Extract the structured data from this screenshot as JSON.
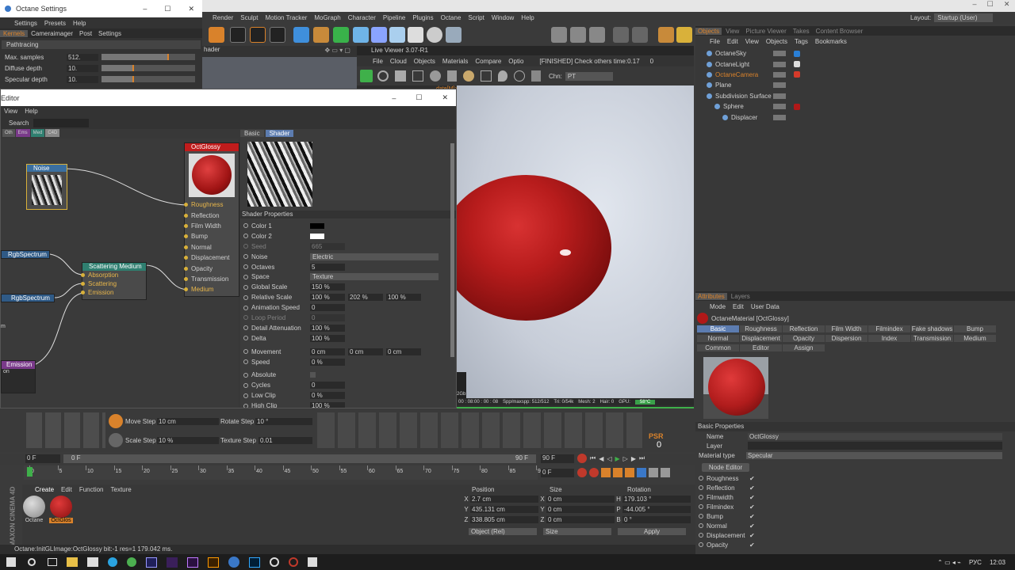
{
  "c4d_menu": [
    "Render",
    "Sculpt",
    "Motion Tracker",
    "MoGraph",
    "Character",
    "Pipeline",
    "Plugins",
    "Octane",
    "Script",
    "Window",
    "Help"
  ],
  "layout": {
    "label": "Layout:",
    "value": "Startup (User)"
  },
  "octane_settings": {
    "title": "Octane Settings",
    "menu": [
      "Settings",
      "Presets",
      "Help"
    ],
    "tabs": [
      "Kernels",
      "Cameraimager",
      "Post",
      "Settings"
    ],
    "mode": "Pathtracing",
    "params": [
      {
        "label": "Max. samples",
        "value": "512.",
        "fill": 0.72
      },
      {
        "label": "Diffuse depth",
        "value": "10.",
        "fill": 0.35
      },
      {
        "label": "Specular depth",
        "value": "10.",
        "fill": 0.35
      }
    ]
  },
  "shader_partial": "hader",
  "live_viewer": {
    "title": "Live Viewer 3.07-R1",
    "menu": [
      "File",
      "Cloud",
      "Objects",
      "Materials",
      "Compare",
      "Optio"
    ],
    "status": "[FINISHED] Check others time:0.17",
    "status_num": "0",
    "chn_label": "Chn:",
    "chn_value": "PT",
    "info_partial": "date[M]:0ms. Mesh:2 Nodes:18 Movable:2  0.0",
    "bottom_status": {
      "time": "00 : 08:00 : 00 : 08",
      "spp": "Spp/maxspp: 512/512",
      "tri": "Tri: 0/54k",
      "mesh": "Mesh: 2",
      "hair": "Hair: 0",
      "gpu": "GPU:",
      "temp": "58°C"
    },
    "left_label": "2Gb"
  },
  "editor": {
    "title": "Editor",
    "menu": [
      "View",
      "Help"
    ],
    "search_label": "Search",
    "filters": [
      "Oth",
      "Ems",
      "Med",
      "C4D"
    ],
    "nodes": {
      "glossy": {
        "title": "OctGlossy",
        "inputs": [
          "Roughness",
          "Reflection",
          "Film Width",
          "Bump",
          "Normal",
          "Displacement",
          "Opacity",
          "Transmission",
          "Medium"
        ]
      },
      "noise": {
        "title": "Noise"
      },
      "rgb1": {
        "title": "RgbSpectrum"
      },
      "rgb2": {
        "title": "RgbSpectrum"
      },
      "scattering": {
        "title": "Scattering Medium",
        "inputs": [
          "Absorption",
          "Scattering",
          "Emission"
        ]
      },
      "emission": {
        "title": "Emission",
        "sub": "on"
      },
      "left_partial": "m"
    },
    "shader_tabs": [
      "Basic",
      "Shader"
    ],
    "shader_props_title": "Shader Properties",
    "props": [
      {
        "label": "Color 1",
        "type": "color",
        "color": "#000000"
      },
      {
        "label": "Color 2",
        "type": "color",
        "color": "#ffffff"
      },
      {
        "label": "Seed",
        "type": "num",
        "v": [
          "665"
        ],
        "disabled": true
      },
      {
        "label": "Noise",
        "type": "drop",
        "v": [
          "Electric"
        ]
      },
      {
        "label": "Octaves",
        "type": "num",
        "v": [
          "5"
        ]
      },
      {
        "label": "Space",
        "type": "drop",
        "v": [
          "Texture"
        ]
      },
      {
        "label": "Global Scale",
        "type": "num",
        "v": [
          "150 %"
        ]
      },
      {
        "label": "Relative Scale",
        "type": "num",
        "v": [
          "100 %",
          "202 %",
          "100 %"
        ]
      },
      {
        "label": "Animation Speed",
        "type": "num",
        "v": [
          "0"
        ]
      },
      {
        "label": "Loop Period",
        "type": "num",
        "v": [
          "0"
        ],
        "disabled": true
      },
      {
        "label": "Detail Attenuation",
        "type": "num",
        "v": [
          "100 %"
        ]
      },
      {
        "label": "Delta",
        "type": "num",
        "v": [
          "100 %"
        ]
      },
      {
        "label": "Movement",
        "type": "num",
        "v": [
          "0 cm",
          "0 cm",
          "0 cm"
        ]
      },
      {
        "label": "Speed",
        "type": "num",
        "v": [
          "0 %"
        ]
      },
      {
        "label": "Absolute",
        "type": "check",
        "v": []
      },
      {
        "label": "Cycles",
        "type": "num",
        "v": [
          "0"
        ]
      },
      {
        "label": "Low Clip",
        "type": "num",
        "v": [
          "0 %"
        ]
      },
      {
        "label": "High Clip",
        "type": "num",
        "v": [
          "100 %"
        ]
      }
    ]
  },
  "objects_panel": {
    "tabs": [
      "Objects",
      "View",
      "Picture Viewer",
      "Takes",
      "Content Browser"
    ],
    "menu": [
      "File",
      "Edit",
      "View",
      "Objects",
      "Tags",
      "Bookmarks"
    ],
    "items": [
      {
        "name": "OctaneSky",
        "indent": 0,
        "tag": "#2a7fd6"
      },
      {
        "name": "OctaneLight",
        "indent": 0,
        "tag": "#dddddd"
      },
      {
        "name": "OctaneCamera",
        "indent": 0,
        "tag": "#d63a2a",
        "highlight": true
      },
      {
        "name": "Plane",
        "indent": 0,
        "tag": ""
      },
      {
        "name": "Subdivision Surface",
        "indent": 0,
        "tag": ""
      },
      {
        "name": "Sphere",
        "indent": 1,
        "tag": "#b01818"
      },
      {
        "name": "Displacer",
        "indent": 2,
        "tag": ""
      }
    ]
  },
  "attributes": {
    "tabs": [
      "Attributes",
      "Layers"
    ],
    "menu": [
      "Mode",
      "Edit",
      "User Data"
    ],
    "material_name": "OctaneMaterial [OctGlossy]",
    "grid": [
      [
        "Basic",
        "Roughness",
        "Reflection",
        "Film Width",
        "Filmindex",
        "Fake shadows",
        "Bump"
      ],
      [
        "Normal",
        "Displacement",
        "Opacity",
        "Dispersion",
        "Index",
        "Transmission",
        "Medium"
      ],
      [
        "Common",
        "Editor",
        "Assign"
      ]
    ],
    "basic_title": "Basic Properties",
    "name_label": "Name",
    "name_value": "OctGlossy",
    "layer_label": "Layer",
    "mat_type_label": "Material type",
    "mat_type_value": "Specular",
    "node_editor": "Node Editor",
    "checks": [
      "Roughness",
      "Reflection",
      "Filmwidth",
      "Filmindex",
      "Bump",
      "Normal",
      "Displacement",
      "Opacity"
    ]
  },
  "tools": {
    "move_step_label": "Move Step",
    "move_step_value": "10 cm",
    "rotate_step_label": "Rotate Step",
    "rotate_step_value": "10 °",
    "scale_step_label": "Scale Step",
    "scale_step_value": "10 %",
    "texture_step_label": "Texture Step",
    "texture_step_value": "0.01",
    "psr": "PSR",
    "psr_num": "0"
  },
  "timeline": {
    "frame_start": "0 F",
    "frame_mid": "0 F",
    "frame_end": "90 F",
    "frame_end2": "90 F",
    "frame_cur": "0 F",
    "ticks": [
      "0",
      "5",
      "10",
      "15",
      "20",
      "25",
      "30",
      "35",
      "40",
      "45",
      "50",
      "55",
      "60",
      "65",
      "70",
      "75",
      "80",
      "85",
      "90"
    ],
    "end_label": "0 F"
  },
  "materials": {
    "menu": [
      "Create",
      "Edit",
      "Function",
      "Texture"
    ],
    "items": [
      {
        "name": "Octane"
      },
      {
        "name": "OctGlos"
      }
    ]
  },
  "coords": {
    "headers": [
      "Position",
      "Size",
      "Rotation"
    ],
    "rows": [
      {
        "axis": "X",
        "pos": "2.7 cm",
        "saxis": "X",
        "size": "0 cm",
        "raxis": "H",
        "rot": "179.103 °"
      },
      {
        "axis": "Y",
        "pos": "435.131 cm",
        "saxis": "Y",
        "size": "0 cm",
        "raxis": "P",
        "rot": "-44.005 °"
      },
      {
        "axis": "Z",
        "pos": "338.805 cm",
        "saxis": "Z",
        "size": "0 cm",
        "raxis": "B",
        "rot": "0 °"
      }
    ],
    "mode": "Object (Rel)",
    "size_mode": "Size",
    "apply": "Apply"
  },
  "status_bar": "Octane:InitGLImage:OctGlossy  bit:-1 res=1  179.042 ms.",
  "brand": "MAXON CINEMA 4D",
  "taskbar": {
    "lang": "РУС",
    "time": "12:03"
  }
}
